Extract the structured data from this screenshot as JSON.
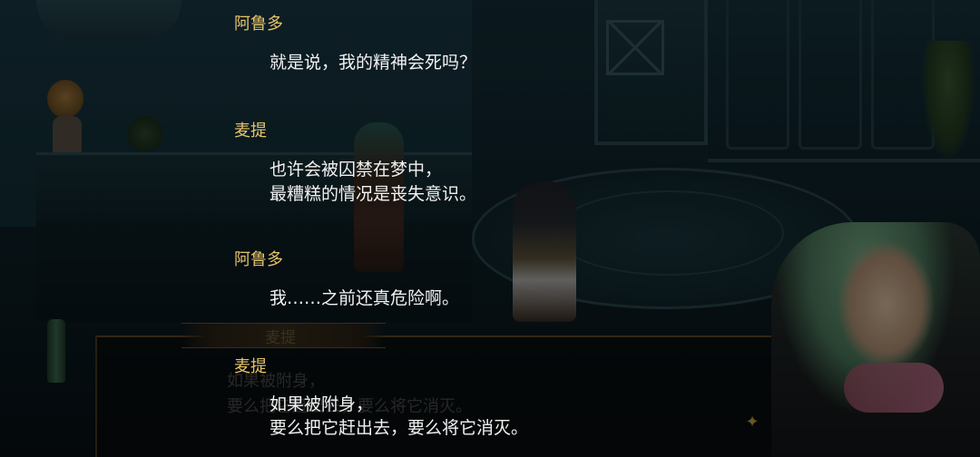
{
  "background_dialog": {
    "speaker": "麦提",
    "lines": [
      "如果被附身，",
      "要么把它赶出去，要么将它消灭。"
    ]
  },
  "log": [
    {
      "speaker": "阿鲁多",
      "lines": [
        "就是说，我的精神会死吗？"
      ]
    },
    {
      "speaker": "麦提",
      "lines": [
        "也许会被囚禁在梦中，",
        "最糟糕的情况是丧失意识。"
      ]
    },
    {
      "speaker": "阿鲁多",
      "lines": [
        "我……之前还真危险啊。"
      ]
    },
    {
      "speaker": "麦提",
      "lines": [
        "如果被附身，",
        "要么把它赶出去，要么将它消灭。"
      ]
    }
  ],
  "colors": {
    "speaker_name": "#e6c46a",
    "dialog_text": "#f2f2f2",
    "overlay": "rgba(0,0,0,0.48)"
  },
  "icons": {
    "dialog_sparkle": "sparkle-icon"
  }
}
